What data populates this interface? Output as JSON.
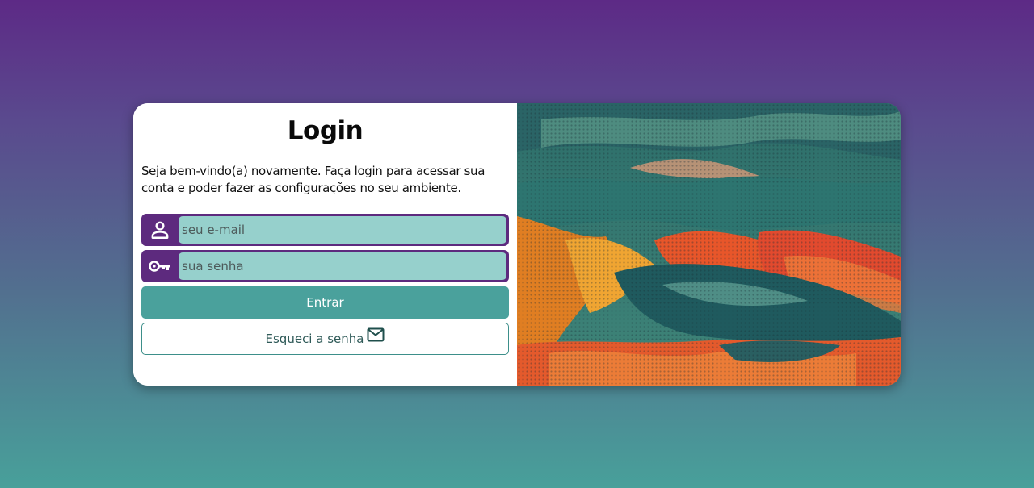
{
  "login": {
    "title": "Login",
    "welcome": "Seja bem-vindo(a) novamente. Faça login para acessar sua conta e poder fazer as configurações no seu ambiente.",
    "email_placeholder": "seu e-mail",
    "password_placeholder": "sua senha",
    "submit_label": "Entrar",
    "forgot_label": "Esqueci a senha",
    "icons": {
      "email": "person-icon",
      "password": "key-icon",
      "forgot": "mail-icon"
    }
  },
  "colors": {
    "field_frame": "#5d2a7e",
    "input_fill": "#96d0cc",
    "primary_button": "#4aa19c",
    "background_top": "#5d2a86",
    "background_bottom": "#48a09a"
  }
}
